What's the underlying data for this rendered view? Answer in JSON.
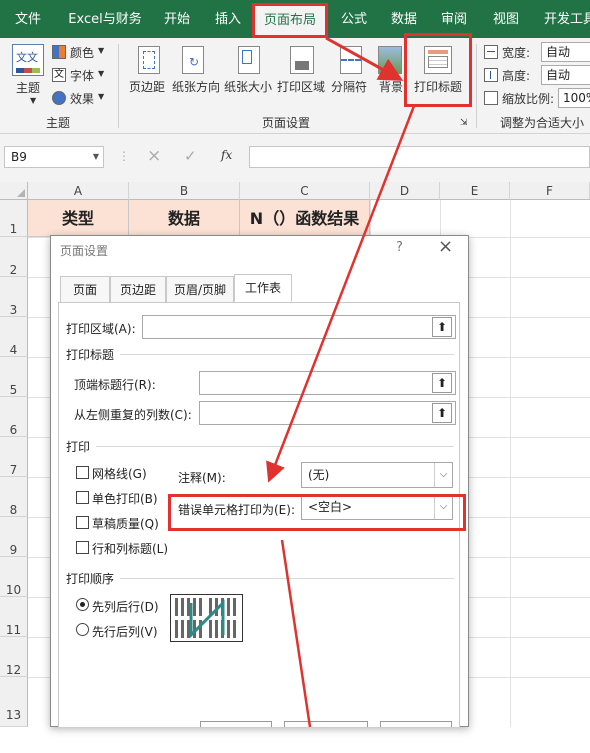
{
  "tabs": [
    {
      "label": "文件"
    },
    {
      "label": "Excel与财务"
    },
    {
      "label": "开始"
    },
    {
      "label": "插入"
    },
    {
      "label": "页面布局"
    },
    {
      "label": "公式"
    },
    {
      "label": "数据"
    },
    {
      "label": "审阅"
    },
    {
      "label": "视图"
    },
    {
      "label": "开发工具"
    }
  ],
  "ribbon": {
    "theme": {
      "main_label": "主题",
      "colors_label": "颜色",
      "fonts_label": "字体",
      "effects_label": "效果",
      "group_label": "主题"
    },
    "page_setup": {
      "margins_label": "页边距",
      "orientation_label": "纸张方向",
      "size_label": "纸张大小",
      "print_area_label": "打印区域",
      "breaks_label": "分隔符",
      "background_label": "背景",
      "print_titles_label": "打印标题",
      "group_label": "页面设置"
    },
    "scale": {
      "width_label": "宽度:",
      "width_value": "自动",
      "height_label": "高度:",
      "height_value": "自动",
      "scale_label": "缩放比例:",
      "scale_value": "100%",
      "group_label": "调整为合适大小"
    }
  },
  "formula_bar": {
    "name_box": "B9",
    "cancel_icon": "×",
    "enter_icon": "✓",
    "fx_label": "fx",
    "value": ""
  },
  "grid": {
    "columns": [
      "A",
      "B",
      "C",
      "D",
      "E",
      "F"
    ],
    "rows": [
      "1",
      "2",
      "3",
      "4",
      "5",
      "6",
      "7",
      "8",
      "9",
      "10",
      "11",
      "12",
      "13"
    ],
    "header_cells": [
      "类型",
      "数据",
      "N（）函数结果"
    ]
  },
  "dialog": {
    "title": "页面设置",
    "help_icon": "?",
    "close_icon": "×",
    "tabs": [
      "页面",
      "页边距",
      "页眉/页脚",
      "工作表"
    ],
    "print_area_label": "打印区域(A):",
    "print_titles_label": "打印标题",
    "rows_repeat_label": "顶端标题行(R):",
    "cols_repeat_label": "从左侧重复的列数(C):",
    "print_label": "打印",
    "gridlines_label": "网格线(G)",
    "bw_label": "单色打印(B)",
    "draft_label": "草稿质量(Q)",
    "headings_label": "行和列标题(L)",
    "comments_label": "注释(M):",
    "comments_value": "(无)",
    "errors_label": "错误单元格打印为(E):",
    "errors_value": "<空白>",
    "order_label": "打印顺序",
    "down_then_over_label": "先列后行(D)",
    "over_then_down_label": "先行后列(V)"
  },
  "colors": {
    "excel_green": "#217346",
    "highlight_red": "#e0322f",
    "header_fill": "#fbe2d5"
  }
}
